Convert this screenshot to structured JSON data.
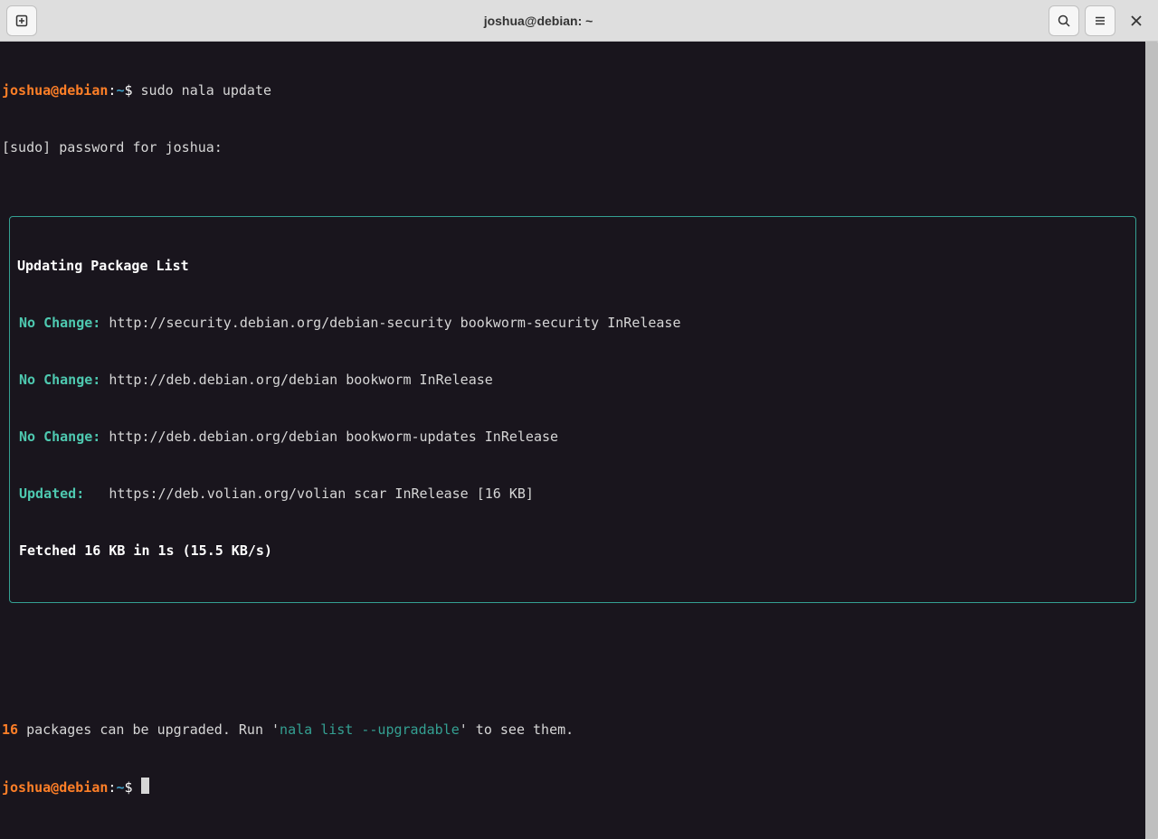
{
  "header": {
    "title": "joshua@debian: ~"
  },
  "prompt": {
    "userhost": "joshua@debian",
    "sep": ":",
    "cwd": "~",
    "sigil": "$"
  },
  "lines": {
    "cmd1": "sudo nala update",
    "sudo_pw": "[sudo] password for joshua:",
    "frame_title": "Updating Package List",
    "repo": [
      {
        "status": "No Change:",
        "url": "http://security.debian.org/debian-security bookworm-security InRelease"
      },
      {
        "status": "No Change:",
        "url": "http://deb.debian.org/debian bookworm InRelease"
      },
      {
        "status": "No Change:",
        "url": "http://deb.debian.org/debian bookworm-updates InRelease"
      },
      {
        "status": "Updated:",
        "url": "https://deb.volian.org/volian scar InRelease [16 KB]"
      }
    ],
    "fetched": "Fetched 16 KB in 1s (15.5 KB/s)",
    "upg_count": "16",
    "upg_mid": " packages can be upgraded. Run '",
    "upg_cmd": "nala list --upgradable",
    "upg_tail": "' to see them."
  }
}
